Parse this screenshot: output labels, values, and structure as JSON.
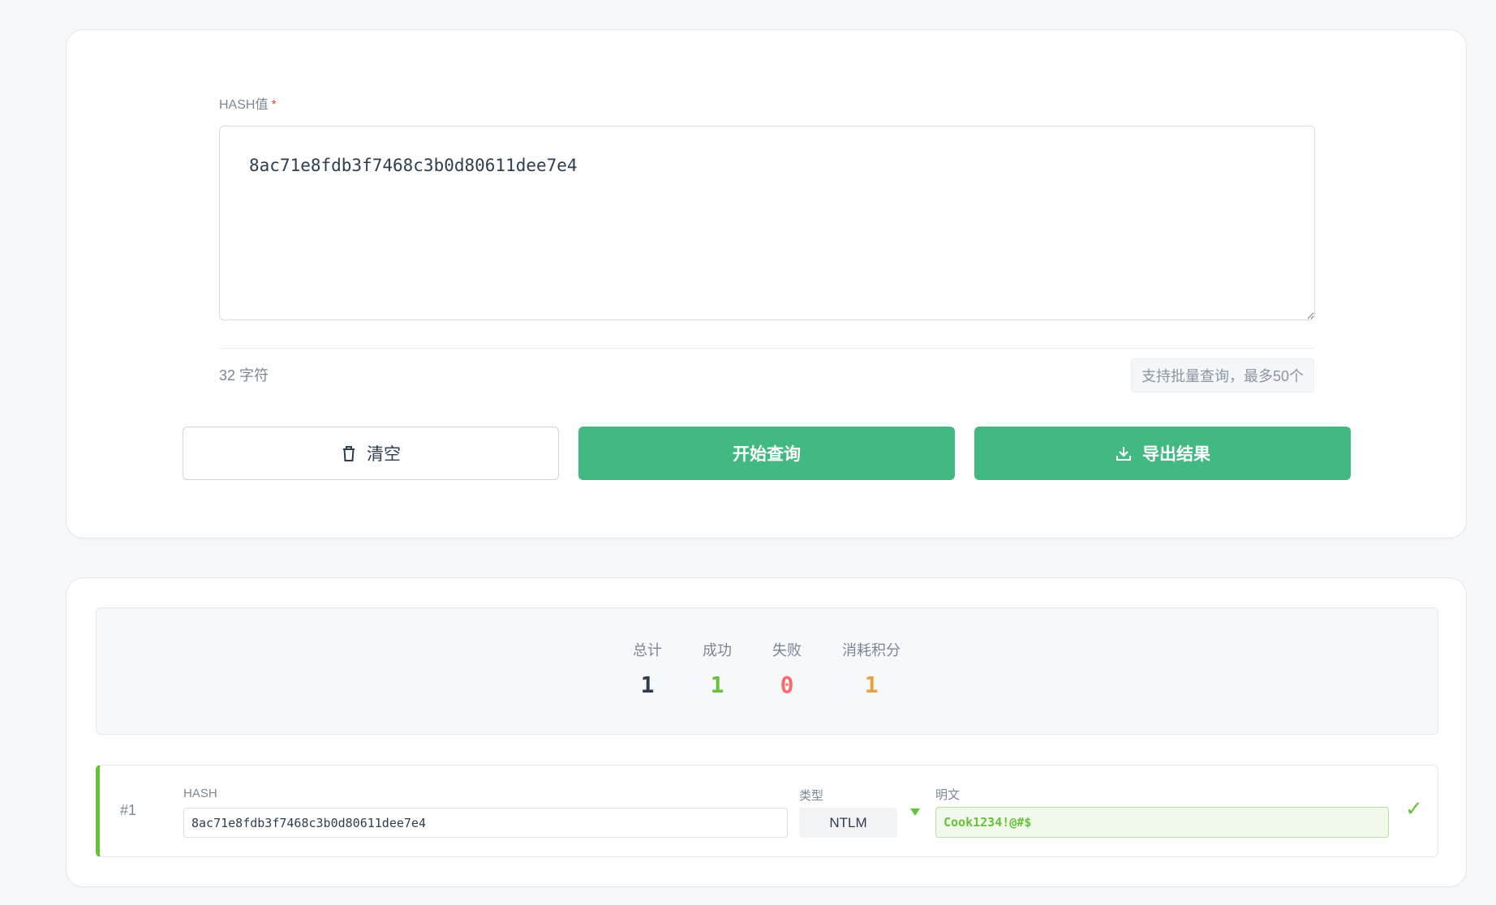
{
  "query_form": {
    "hash_label": "HASH值",
    "required_mark": "*",
    "hash_value": "8ac71e8fdb3f7468c3b0d80611dee7e4",
    "char_count": "32 字符",
    "hint": "支持批量查询，最多50个",
    "buttons": {
      "clear": "清空",
      "query": "开始查询",
      "export": "导出结果"
    }
  },
  "stats": {
    "total_label": "总计",
    "total_value": "1",
    "success_label": "成功",
    "success_value": "1",
    "failed_label": "失败",
    "failed_value": "0",
    "credits_label": "消耗积分",
    "credits_value": "1"
  },
  "results": [
    {
      "index": "#1",
      "hash_label": "HASH",
      "hash": "8ac71e8fdb3f7468c3b0d80611dee7e4",
      "type_label": "类型",
      "type": "NTLM",
      "plain_label": "明文",
      "plain": "Cook1234!@#$",
      "status_icon": "check-icon"
    }
  ],
  "colors": {
    "primary": "#42b883",
    "success": "#67c23a",
    "danger": "#f56c6c",
    "warning": "#e6a23c",
    "text": "#2c3e50"
  }
}
